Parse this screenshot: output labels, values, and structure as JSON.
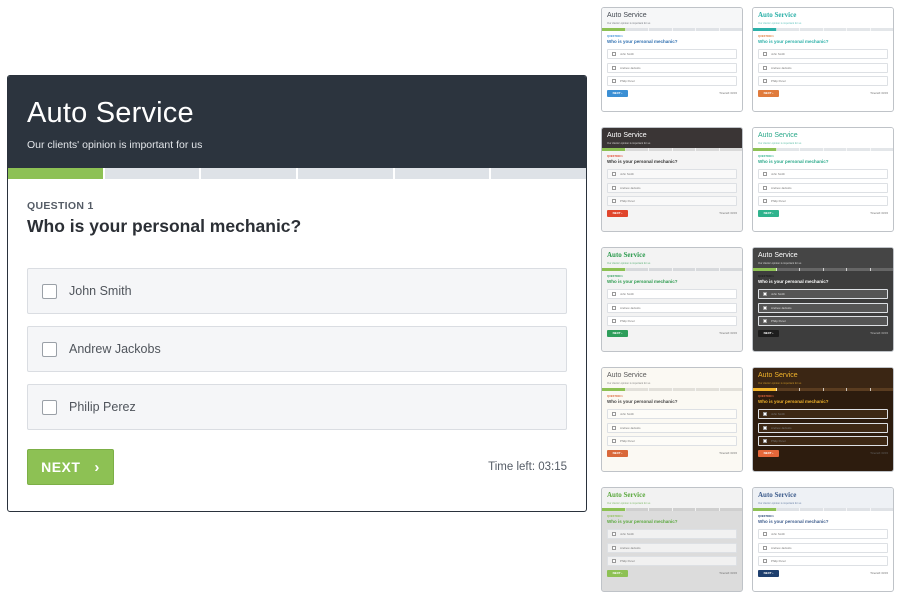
{
  "form": {
    "title": "Auto Service",
    "subtitle": "Our clients' opinion is important for us",
    "progress": {
      "completed": 1,
      "total": 6
    },
    "question_number": "QUESTION 1",
    "question_text": "Who is your personal mechanic?",
    "options": [
      {
        "label": "John Smith",
        "checked": false
      },
      {
        "label": "Andrew Jackobs",
        "checked": false
      },
      {
        "label": "Philip Perez",
        "checked": false
      }
    ],
    "next_label": "NEXT",
    "next_icon": "chevron-right-icon",
    "timer": "Time left: 03:15"
  },
  "colors": {
    "header_bg": "#2c343e",
    "accent_green": "#8dc154",
    "progress_track": "#dee2e7",
    "option_bg": "#f5f6f8"
  },
  "themes": [
    {
      "name": "light-blue",
      "header_bg": "#f6f7f8",
      "title_color": "#444a52",
      "title_font": "sans",
      "body_bg": "#ffffff",
      "opt_bg": "#ffffff",
      "q_color": "#2f6fb0",
      "btn": "#3b8fd4",
      "prog": "#8dc154",
      "track": "#dfe2e6"
    },
    {
      "name": "teal-orange",
      "header_bg": "#ffffff",
      "title_color": "#2bb0a8",
      "title_font": "serif",
      "body_bg": "#ffffff",
      "opt_bg": "#ffffff",
      "q_color": "#2bb0a8",
      "btn": "#e07b3c",
      "prog": "#2bb0a8",
      "track": "#e3e6e9"
    },
    {
      "name": "dark-red",
      "header_bg": "#3a3535",
      "title_color": "#ffffff",
      "title_font": "sans",
      "body_bg": "#f4f4f4",
      "opt_bg": "#f9f9f9",
      "q_color": "#333333",
      "btn": "#e0452c",
      "prog": "#8dc154",
      "track": "#d9d9d9"
    },
    {
      "name": "mint",
      "header_bg": "#ffffff",
      "title_color": "#2aa98a",
      "title_font": "sans",
      "body_bg": "#ffffff",
      "opt_bg": "#ffffff",
      "q_color": "#2aa98a",
      "btn": "#2fb38d",
      "prog": "#8dc154",
      "track": "#e3e6e9"
    },
    {
      "name": "green-serif",
      "header_bg": "#f3f3f3",
      "title_color": "#2b9a4d",
      "title_font": "serif",
      "body_bg": "#f3f3f3",
      "opt_bg": "#ffffff",
      "q_color": "#2b9a4d",
      "btn": "#2e9e5b",
      "prog": "#8dc154",
      "track": "#d7d9dc"
    },
    {
      "name": "charcoal",
      "header_bg": "#454545",
      "title_color": "#ffffff",
      "title_font": "sans",
      "body_bg": "#3d3d3d",
      "opt_bg": "#555555",
      "q_color": "#ffffff",
      "btn": "#1d1d1d",
      "prog": "#8dc154",
      "track": "#666666"
    },
    {
      "name": "cream-orange",
      "header_bg": "#fbf9f3",
      "title_color": "#5a5a5a",
      "title_font": "sans",
      "body_bg": "#fbf9f3",
      "opt_bg": "#fdfcf8",
      "q_color": "#444444",
      "btn": "#d9683a",
      "prog": "#8dc154",
      "track": "#e2e0da"
    },
    {
      "name": "brown-gold",
      "header_bg": "#3b2614",
      "title_color": "#f2b42a",
      "title_font": "sans",
      "body_bg": "#2d1c0e",
      "opt_bg": "#3d2814",
      "q_color": "#f2b42a",
      "btn": "#e5673a",
      "prog": "#f2b42a",
      "track": "#5a3c20"
    },
    {
      "name": "gray-lime",
      "header_bg": "#f2f2f2",
      "title_color": "#5aa83d",
      "title_font": "serif",
      "body_bg": "#dcdcdc",
      "opt_bg": "#f1f1f1",
      "q_color": "#5aa83d",
      "btn": "#8dc154",
      "prog": "#8dc154",
      "track": "#cfcfcf"
    },
    {
      "name": "navy-serif",
      "header_bg": "#eef1f5",
      "title_color": "#3d5c8c",
      "title_font": "serif",
      "body_bg": "#ffffff",
      "opt_bg": "#ffffff",
      "q_color": "#3d5c8c",
      "btn": "#1e3f6e",
      "prog": "#8dc154",
      "track": "#dfe2e6"
    }
  ]
}
